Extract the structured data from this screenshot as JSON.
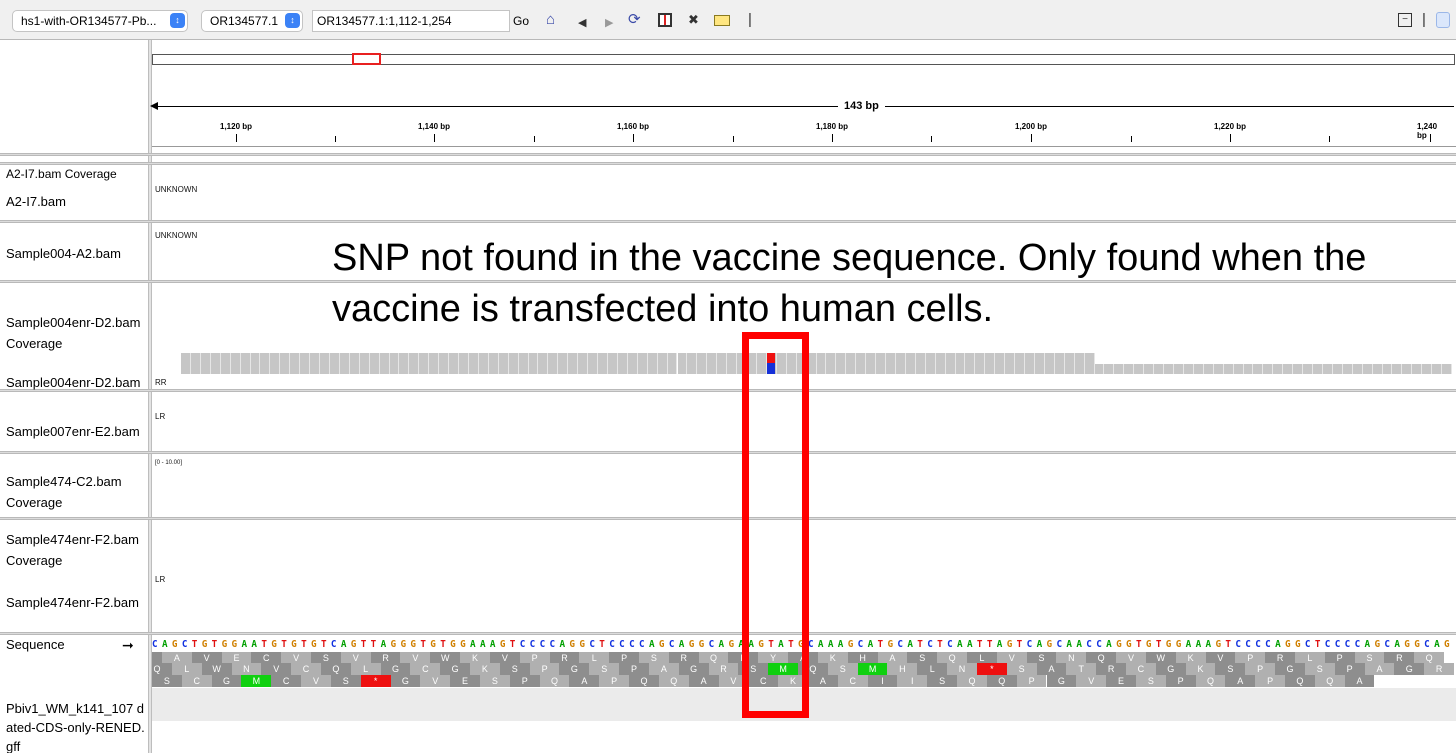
{
  "toolbar": {
    "genome": "hs1-with-OR134577-Pb...",
    "chromosome": "OR134577.1",
    "locus": "OR134577.1:1,112-1,254",
    "go_label": "Go",
    "home_icon": "home-icon",
    "back_icon": "back-arrow-icon",
    "forward_icon": "forward-arrow-icon",
    "refresh_icon": "refresh-icon",
    "roi_icon": "region-of-interest-icon",
    "resize_icon": "fit-window-icon",
    "popup_icon": "popup-text-icon"
  },
  "ruler": {
    "span_label": "143 bp",
    "ticks": [
      "1,120 bp",
      "1,140 bp",
      "1,160 bp",
      "1,180 bp",
      "1,200 bp",
      "1,220 bp",
      "1,240 bp"
    ]
  },
  "tracks": {
    "a2_cov": "A2-I7.bam Coverage",
    "a2_bam": "A2-I7.bam",
    "s004": "Sample004-A2.bam",
    "s004enr_cov": "Sample004enr-D2.bam Coverage",
    "s004enr_bam": "Sample004enr-D2.bam",
    "s007enr": "Sample007enr-E2.bam",
    "s474_cov": "Sample474-C2.bam Coverage",
    "s474enr_cov": "Sample474enr-F2.bam Coverage",
    "s474enr_bam": "Sample474enr-F2.bam",
    "sequence": "Sequence",
    "gff": "Pbiv1_WM_k141_107 dated-CDS-only-RENED.gff"
  },
  "tags": {
    "unknown1": "UNKNOWN",
    "unknown2": "UNKNOWN",
    "rr": "RR",
    "lr1": "LR",
    "range": "[0 - 10.00]",
    "lr2": "LR"
  },
  "annotation": "SNP not found in the vaccine sequence. Only found when the vaccine is transfected into human cells.",
  "sequence": "CAGCTGTGGAATGTGTGTCAGTTAGGGTGTGGAAAGTCCCCAGGCTCCCCAGCAGGCAGAAGTATGCAAAGCATGCATCTCAATTAGTCAGCAACCAGGTGTGGAAAGTCCCCAGGCTCCCCAGCAGGCAG",
  "frame1": "PAVECVSVRVWKVPRLPSRQKYAKHASQLVSNQVWKVPRLPSRQ",
  "frame2": "QLWNVCQLGCGKSPGSPAGRSMQSMHLN*SATRCGKSPGSPAGR",
  "frame3": "SCGMCVS*GVESPQAPQQAVCKACIISQQPGVESPQAPQQA",
  "colors": {
    "snp_highlight": "#ff0000",
    "A": "#00a000",
    "C": "#1030e0",
    "G": "#d08000",
    "T": "#e01010"
  }
}
